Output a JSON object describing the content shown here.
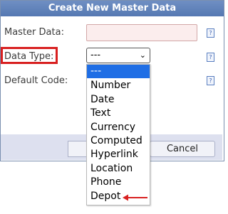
{
  "dialog": {
    "title": "Create New Master Data",
    "master_data_label": "Master Data:",
    "data_type_label": "Data Type:",
    "default_code_label": "Default Code:",
    "master_data_value": "",
    "data_type_value": "---",
    "help_glyph": "?",
    "cancel_label": "Cancel",
    "ok_label": ""
  },
  "dropdown": {
    "options": [
      "---",
      "Number",
      "Date",
      "Text",
      "Currency",
      "Computed",
      "Hyperlink",
      "Location",
      "Phone",
      "Depot"
    ],
    "selected_index": 0
  },
  "colors": {
    "title_bar": "#5f82bb",
    "highlight": "#d82020",
    "selected_option": "#1f6ee5",
    "annotation_arrow": "#d82020"
  }
}
